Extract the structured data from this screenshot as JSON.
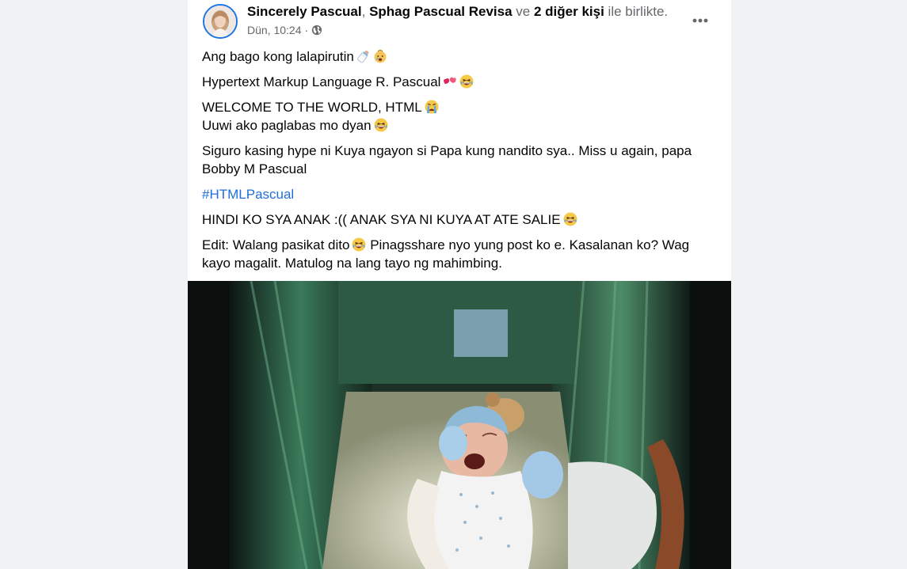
{
  "post": {
    "authors": {
      "first": "Sincerely Pascual",
      "separator": ",",
      "second": "Sphag Pascual Revisa",
      "connector": "ve",
      "others": "2 diğer kişi",
      "suffix": "ile birlikte."
    },
    "timestamp": "Dün, 10:24",
    "dot": "·",
    "privacy_icon": "globe-icon",
    "menu_icon": "more-options-icon",
    "paragraphs": [
      {
        "text": "Ang bago kong lalapirutin",
        "emojis": [
          "baby-bottle-emoji",
          "crying-baby-emoji"
        ]
      },
      {
        "text": "Hypertext Markup Language R. Pascual",
        "emojis": [
          "hearts-emoji",
          "laughing-emoji"
        ]
      },
      {
        "line1": "WELCOME TO THE WORLD, HTML",
        "line1_emoji": "crying-face-emoji",
        "line2": "Uuwi ako paglabas mo dyan",
        "line2_emoji": "laughing-emoji"
      },
      {
        "text": "Siguro kasing hype ni Kuya ngayon si Papa kung nandito sya.. Miss u again, papa Bobby M Pascual"
      },
      {
        "hashtag": "#HTMLPascual"
      },
      {
        "text": "HINDI KO SYA ANAK :(( ANAK SYA NI KUYA AT ATE SALIE",
        "emojis": [
          "laughing-emoji"
        ]
      },
      {
        "text_before": "Edit: Walang pasikat dito",
        "emoji": "laughing-emoji",
        "text_after": "Pinagsshare nyo yung post ko e. Kasalanan ko? Wag kayo magalit. Matulog na lang tayo ng mahimbing."
      }
    ],
    "photo": "newborn-baby-in-hospital-bassinet"
  },
  "colors": {
    "page_background": "#f0f2f5",
    "card_background": "#ffffff",
    "text_primary": "#050505",
    "text_secondary": "#65676b",
    "link": "#216fdb",
    "avatar_ring": "#1b74e4"
  }
}
